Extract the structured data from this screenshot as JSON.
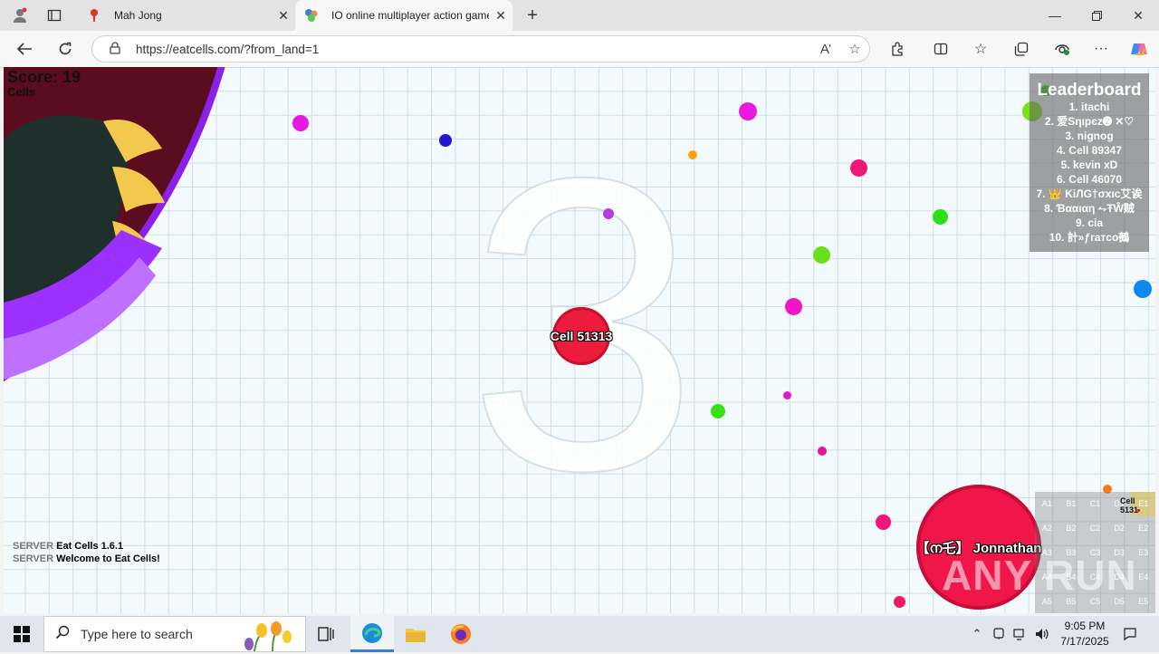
{
  "browser": {
    "tabs": [
      {
        "title": "Mah Jong",
        "active": false
      },
      {
        "title": "IO online multiplayer action game",
        "active": true
      }
    ],
    "url": "https://eatcells.com/?from_land=1"
  },
  "game": {
    "score_label": "Score: 19",
    "cells_label": "Cells",
    "countdown": "3",
    "player_cell_label": "Cell 51313",
    "other_cell_label": "【ന乇】 Jonnathan",
    "leaderboard": {
      "title": "Leaderboard",
      "entries": [
        "1. itachi",
        "2. 爱Sηιpєz➋ ✕♡",
        "3. nignog",
        "4. Cell 89347",
        "5. kevin xD",
        "6. Cell 46070",
        "7. 👑 KiЛG†σxιc艾诶",
        "8. Ɓααιαη ⥊ŦŴ贼",
        "9. cia",
        "10. 計»ƒraтco鵺"
      ]
    },
    "chat": [
      {
        "sender": "SERVER",
        "text": "Eat Cells 1.6.1"
      },
      {
        "sender": "SERVER",
        "text": "Welcome to Eat Cells!"
      }
    ],
    "minimap": {
      "cells": [
        "A1",
        "B1",
        "C1",
        "D1",
        "E1",
        "A2",
        "B2",
        "C2",
        "D2",
        "E2",
        "A3",
        "B3",
        "C3",
        "D3",
        "E3",
        "A4",
        "B4",
        "C4",
        "D4",
        "E4",
        "A5",
        "B5",
        "C5",
        "D5",
        "E5"
      ],
      "player_label": "Cell 5131"
    },
    "watermark": "ANY RUN",
    "colors": {
      "player": "#ee1c3c",
      "other": "#f0164a"
    }
  },
  "taskbar": {
    "search_placeholder": "Type here to search",
    "time": "9:05 PM",
    "date": "7/17/2025"
  }
}
